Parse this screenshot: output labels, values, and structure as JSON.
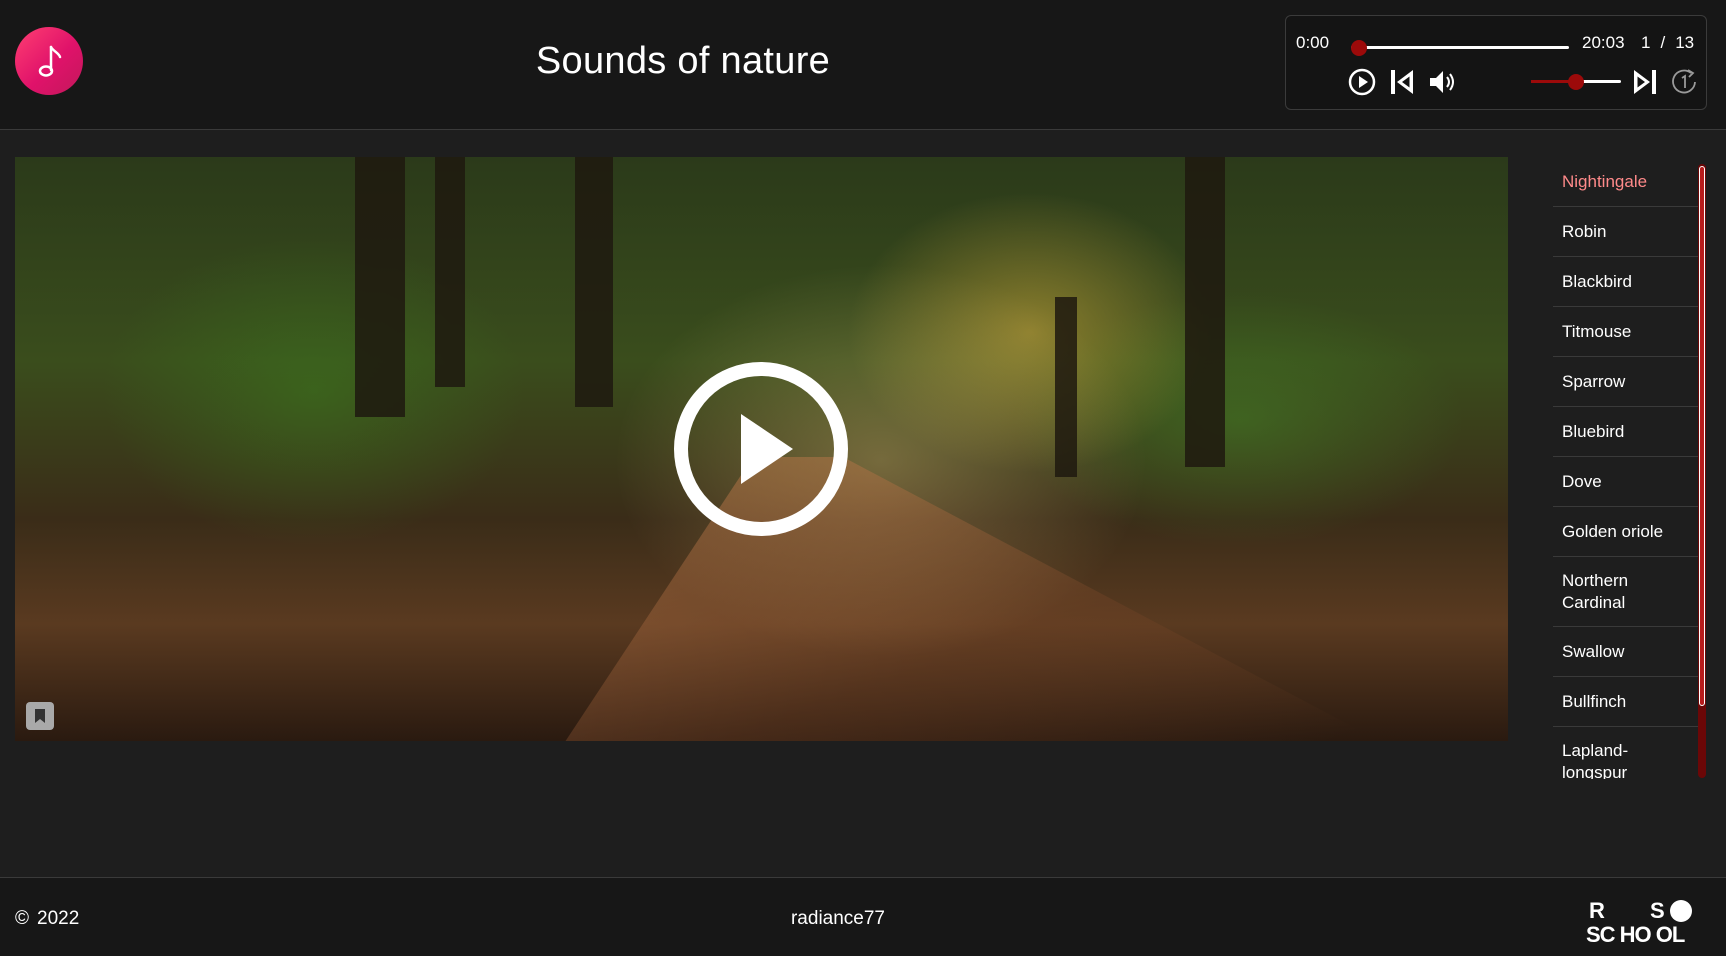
{
  "header": {
    "title": "Sounds of nature",
    "logo_icon": "music-note-icon"
  },
  "player": {
    "current_time": "0:00",
    "total_time": "20:03",
    "track_index": "1",
    "separator": "/",
    "track_count": "13",
    "progress_fraction": 0,
    "volume_fraction": 0.5,
    "accent_color": "#9c0a0a",
    "controls": {
      "play_icon": "play-icon",
      "prev_icon": "previous-track-icon",
      "volume_icon": "volume-icon",
      "next_icon": "next-track-icon",
      "repeat_icon": "repeat-one-icon"
    }
  },
  "video": {
    "overlay_icon": "play-circle-icon",
    "bookmark_icon": "bookmark-icon"
  },
  "playlist": {
    "active_color": "#ff8a8a",
    "items": [
      {
        "label": "Nightingale"
      },
      {
        "label": "Robin"
      },
      {
        "label": "Blackbird"
      },
      {
        "label": "Titmouse"
      },
      {
        "label": "Sparrow"
      },
      {
        "label": "Bluebird"
      },
      {
        "label": "Dove"
      },
      {
        "label": "Golden oriole"
      },
      {
        "label": "Northern Cardinal"
      },
      {
        "label": "Swallow"
      },
      {
        "label": "Bullfinch"
      },
      {
        "label": "Lapland-longspur"
      }
    ]
  },
  "footer": {
    "copyright_symbol": "©",
    "year": "2022",
    "author": "radiance77",
    "school_logo_text": {
      "r": "R",
      "s": "S",
      "line2": "SC HO OL"
    }
  }
}
